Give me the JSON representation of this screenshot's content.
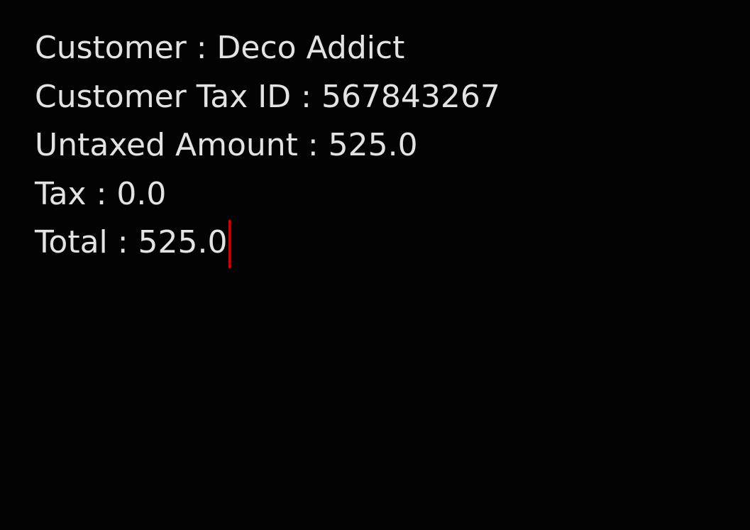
{
  "document": {
    "lines": [
      "Customer : Deco Addict",
      "Customer Tax ID : 567843267",
      "Untaxed Amount : 525.0",
      "Tax : 0.0",
      "Total : 525.0"
    ]
  },
  "colors": {
    "background": "#030303",
    "text": "#e3e3e3",
    "cursor": "#d10000"
  }
}
